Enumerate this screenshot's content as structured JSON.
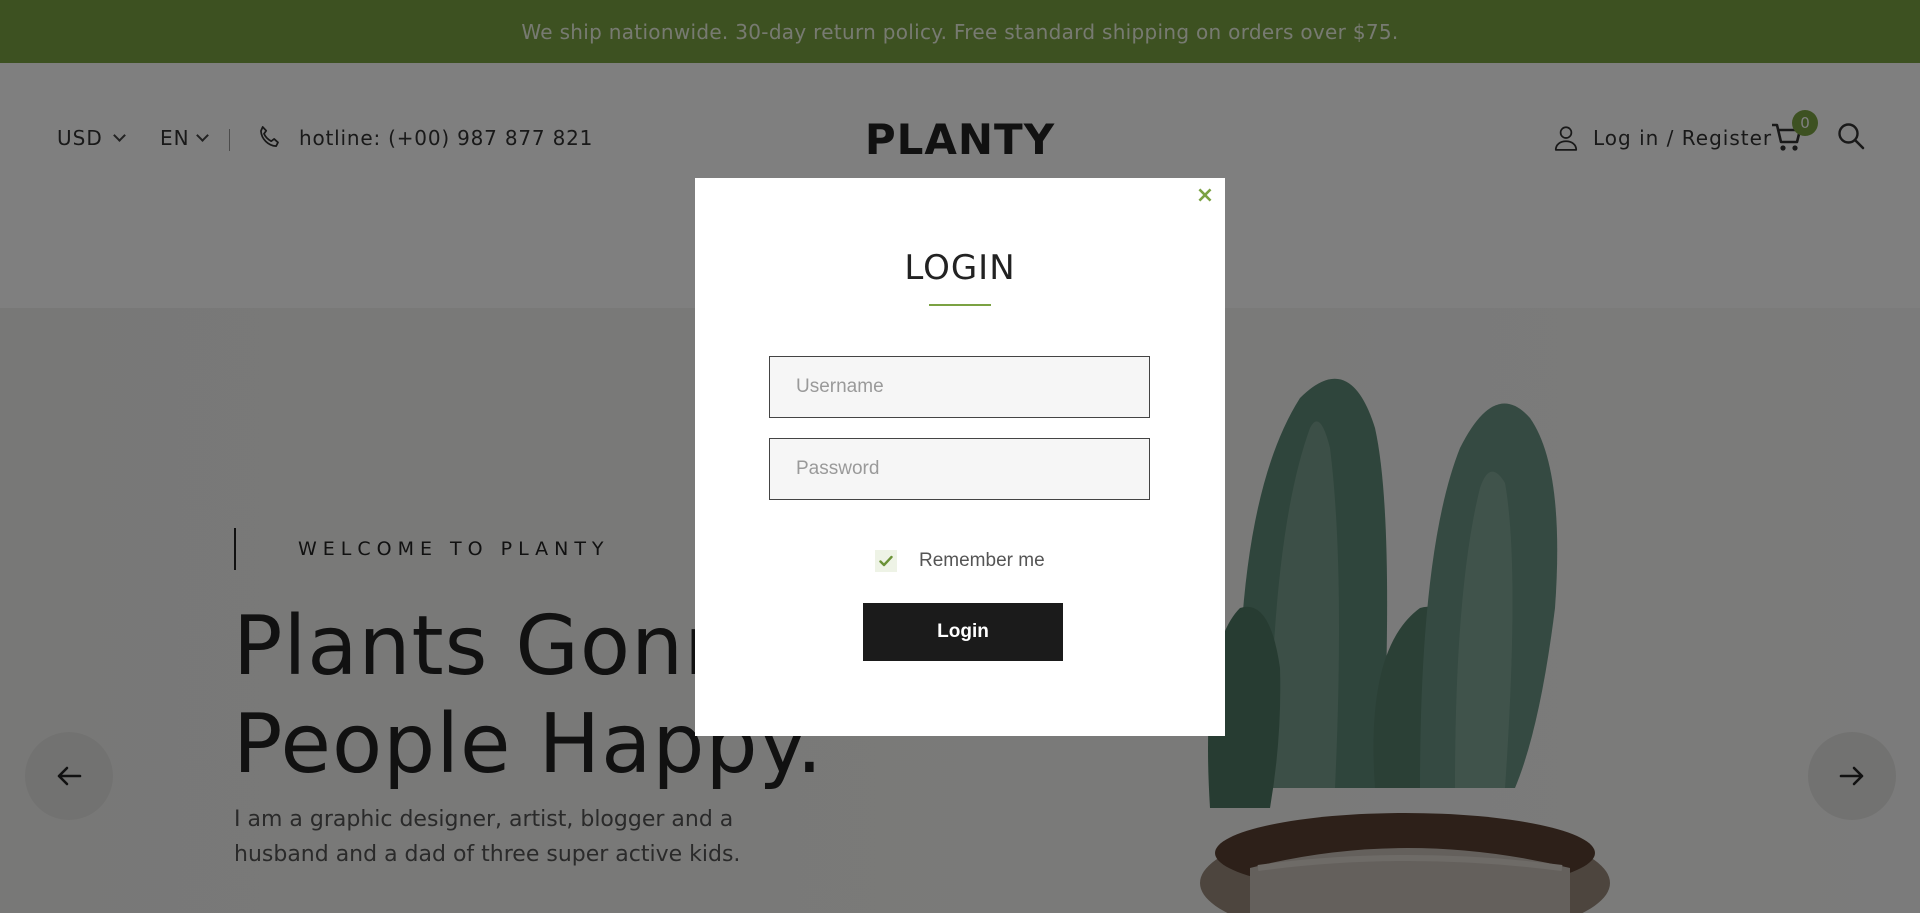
{
  "topbar": {
    "message": "We ship nationwide. 30-day return policy. Free standard shipping on orders over $75."
  },
  "header": {
    "currency": "USD",
    "language": "EN",
    "hotline": "hotline: (+00) 987 877 821",
    "logo": "PLANTY",
    "account_label": "Log in / Register",
    "cart_count": "0"
  },
  "hero": {
    "eyebrow": "WELCOME TO PLANTY",
    "headline_line1": "Plants Gonna Make",
    "headline_line2": "People Happy.",
    "description": "I am a graphic designer, artist, blogger and a husband and a dad of three super active kids."
  },
  "modal": {
    "close_glyph": "×",
    "title": "LOGIN",
    "username_placeholder": "Username",
    "password_placeholder": "Password",
    "remember_label": "Remember me",
    "remember_checked": true,
    "login_label": "Login"
  },
  "colors": {
    "accent": "#7ba243",
    "button": "#1b1b1b",
    "overlay": "rgba(0,0,0,0.5)"
  },
  "icons": [
    "phone-icon",
    "user-icon",
    "cart-icon",
    "search-icon",
    "arrow-left-icon",
    "arrow-right-icon",
    "close-icon",
    "check-icon",
    "chevron-down-icon"
  ]
}
